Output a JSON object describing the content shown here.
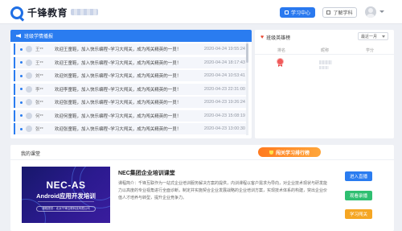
{
  "header": {
    "logo_text": "千锋教育",
    "study_center": "学习中心",
    "learn_subject": "了解学科"
  },
  "notices": {
    "title": "班级学情播报",
    "rows": [
      {
        "name": "王**",
        "msg": "欢迎王童鞋，加入快乐编程~学习大闯关，成为闯关精英的一员！",
        "time": "2020-04-24 19:55:24"
      },
      {
        "name": "王**",
        "msg": "欢迎王童鞋，加入快乐编程~学习大闯关，成为闯关精英的一员！",
        "time": "2020-04-24 18:17:43"
      },
      {
        "name": "刘**",
        "msg": "欢迎刘童鞋，加入快乐编程~学习大闯关，成为闯关精英的一员！",
        "time": "2020-04-24 10:53:41"
      },
      {
        "name": "李**",
        "msg": "欢迎李童鞋，加入快乐编程~学习大闯关，成为闯关精英的一员！",
        "time": "2020-04-23 22:31:00"
      },
      {
        "name": "张**",
        "msg": "欢迎张童鞋，加入快乐编程~学习大闯关，成为闯关精英的一员！",
        "time": "2020-04-23 19:26:24"
      },
      {
        "name": "何**",
        "msg": "欢迎何童鞋，加入快乐编程~学习大闯关，成为闯关精英的一员！",
        "time": "2020-04-23 15:08:19"
      },
      {
        "name": "张**",
        "msg": "欢迎张童鞋，加入快乐编程~学习大闯关，成为闯关精英的一员！",
        "time": "2020-04-23 13:00:30"
      }
    ]
  },
  "ranking": {
    "title": "班级英雄榜",
    "select_value": "最近一月",
    "col_rank": "排名",
    "col_nick": "昵称",
    "col_score": "学分"
  },
  "course": {
    "section_title": "我的课堂",
    "rank_button": "闯关学习排行榜",
    "cover_title1": "NEC-AS",
    "cover_title2": "Android应用开发培训",
    "cover_foot": "课程提供：北京千锋互联科技有限公司",
    "name": "NEC集团企业培训课堂",
    "desc": "课程简介：千锋互联作为一站式企业培训服务解决方案的提供，内训课程以客户需求为导向，对企业技术现状与研发能力以高度的专业视角进行全面诊断，制定并实施契合企业发展战略的企业培训方案，实现技术体系的构建，突出企业价值人才培养与转型，提升企业竞争力。",
    "btn_live": "进入直播",
    "btn_replay": "观看录播",
    "btn_learn": "学习闯关"
  },
  "colors": {
    "primary": "#2a7cf0",
    "green": "#2fbf71",
    "orange": "#f5a623"
  }
}
